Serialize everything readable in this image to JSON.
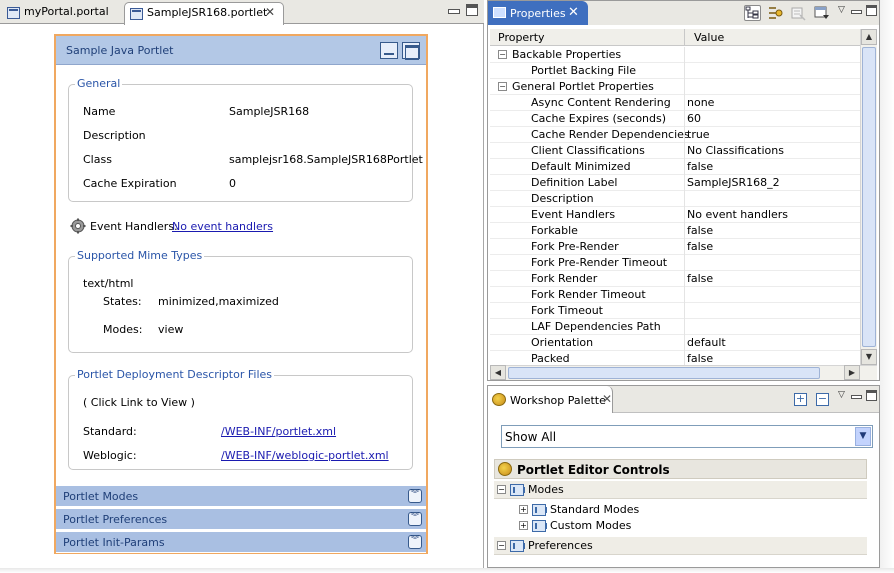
{
  "editor": {
    "tabs": [
      {
        "label": "myPortal.portal",
        "active": false
      },
      {
        "label": "SampleJSR168.portlet",
        "active": true
      }
    ]
  },
  "portlet": {
    "title": "Sample Java Portlet",
    "general": {
      "label": "General",
      "rows": [
        {
          "name": "Name",
          "value": "SampleJSR168"
        },
        {
          "name": "Description",
          "value": ""
        },
        {
          "name": "Class",
          "value": "samplejsr168.SampleJSR168Portlet"
        },
        {
          "name": "Cache Expiration",
          "value": "0"
        }
      ]
    },
    "events": {
      "label": "Event Handlers:",
      "link": "No event handlers"
    },
    "mime": {
      "label": "Supported Mime Types",
      "type": "text/html",
      "states_label": "States:",
      "states_value": "minimized,maximized",
      "modes_label": "Modes:",
      "modes_value": "view"
    },
    "descriptors": {
      "label": "Portlet Deployment Descriptor Files",
      "hint": "( Click Link to View )",
      "standard_label": "Standard:",
      "standard_link": "/WEB-INF/portlet.xml",
      "weblogic_label": "Weblogic:",
      "weblogic_link": "/WEB-INF/weblogic-portlet.xml"
    },
    "sections": [
      "Portlet Modes",
      "Portlet Preferences",
      "Portlet Init-Params"
    ]
  },
  "properties": {
    "tab_label": "Properties",
    "col_property": "Property",
    "col_value": "Value",
    "rows": [
      {
        "name": "Backable Properties",
        "value": "",
        "category": true
      },
      {
        "name": "Portlet Backing File",
        "value": "",
        "category": false
      },
      {
        "name": "General Portlet Properties",
        "value": "",
        "category": true
      },
      {
        "name": "Async Content Rendering",
        "value": "none",
        "category": false
      },
      {
        "name": "Cache Expires (seconds)",
        "value": "60",
        "category": false
      },
      {
        "name": "Cache Render Dependencies",
        "value": "true",
        "category": false
      },
      {
        "name": "Client Classifications",
        "value": "No Classifications",
        "category": false
      },
      {
        "name": "Default Minimized",
        "value": "false",
        "category": false
      },
      {
        "name": "Definition Label",
        "value": "SampleJSR168_2",
        "category": false
      },
      {
        "name": "Description",
        "value": "",
        "category": false
      },
      {
        "name": "Event Handlers",
        "value": "No event handlers",
        "category": false
      },
      {
        "name": "Forkable",
        "value": "false",
        "category": false
      },
      {
        "name": "Fork Pre-Render",
        "value": "false",
        "category": false
      },
      {
        "name": "Fork Pre-Render Timeout",
        "value": "",
        "category": false
      },
      {
        "name": "Fork Render",
        "value": "false",
        "category": false
      },
      {
        "name": "Fork Render Timeout",
        "value": "",
        "category": false
      },
      {
        "name": "Fork Timeout",
        "value": "",
        "category": false
      },
      {
        "name": "LAF Dependencies Path",
        "value": "",
        "category": false
      },
      {
        "name": "Orientation",
        "value": "default",
        "category": false
      },
      {
        "name": "Packed",
        "value": "false",
        "category": false
      }
    ]
  },
  "palette": {
    "tab_label": "Workshop Palette",
    "filter_value": "Show All",
    "drawer_title": "Portlet Editor Controls",
    "items": [
      {
        "label": "Modes",
        "level": 0,
        "expanded": true
      },
      {
        "label": "Standard Modes",
        "level": 1,
        "expanded": false
      },
      {
        "label": "Custom Modes",
        "level": 1,
        "expanded": false
      },
      {
        "label": "Preferences",
        "level": 0,
        "expanded": true
      }
    ]
  },
  "colors": {
    "portlet_border": "#f0a860",
    "titlebar": "#b3c8e6",
    "section_bar": "#a9bfe2",
    "properties_tab": "#3f6fbf",
    "group_label": "#2a55a8"
  }
}
